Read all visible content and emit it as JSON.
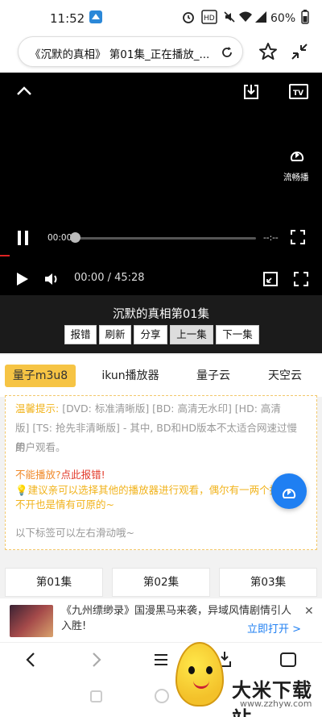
{
  "status": {
    "time": "11:52",
    "battery": "60%"
  },
  "browser": {
    "url_title": "《沉默的真相》 第01集_正在播放_..."
  },
  "player": {
    "current_time_small": "00:00",
    "duration_small": "--:--",
    "time_display": "00:00 / 45:28",
    "smooth_label": "流畅播",
    "progress": 0
  },
  "episode_title": "沉默的真相第01集",
  "actions": [
    "报错",
    "刷新",
    "分享",
    "上一集",
    "下一集"
  ],
  "sources": [
    "量子m3u8",
    "ikun播放器",
    "量子云",
    "天空云"
  ],
  "notice": {
    "line1a": "温馨提示: ",
    "line1b": "[DVD: 标准清晰版] [BD: 高清无水印] [HD: 高清",
    "line2": "版] [TS: 抢先非清晰版] - 其中, BD和HD版本不太适合网速过慢的",
    "line3": "用户观看。",
    "cannot_play": "不能播放?",
    "report": "点此报错!",
    "tip1": "建议亲可以选择其他的播放器进行观看，偶尔有一两个播",
    "tip2": "不开也是情有可原的~",
    "swipe": "以下标签可以左右滑动哦~"
  },
  "episodes": [
    "第01集",
    "第02集",
    "第03集"
  ],
  "ad": {
    "text": "《九州缥缈录》国漫黑马来袭，异域风情剧情引人入胜!",
    "open": "立即打开 >"
  },
  "watermark": {
    "brand": "大米下载站",
    "url": "www.zzhyw.com"
  }
}
